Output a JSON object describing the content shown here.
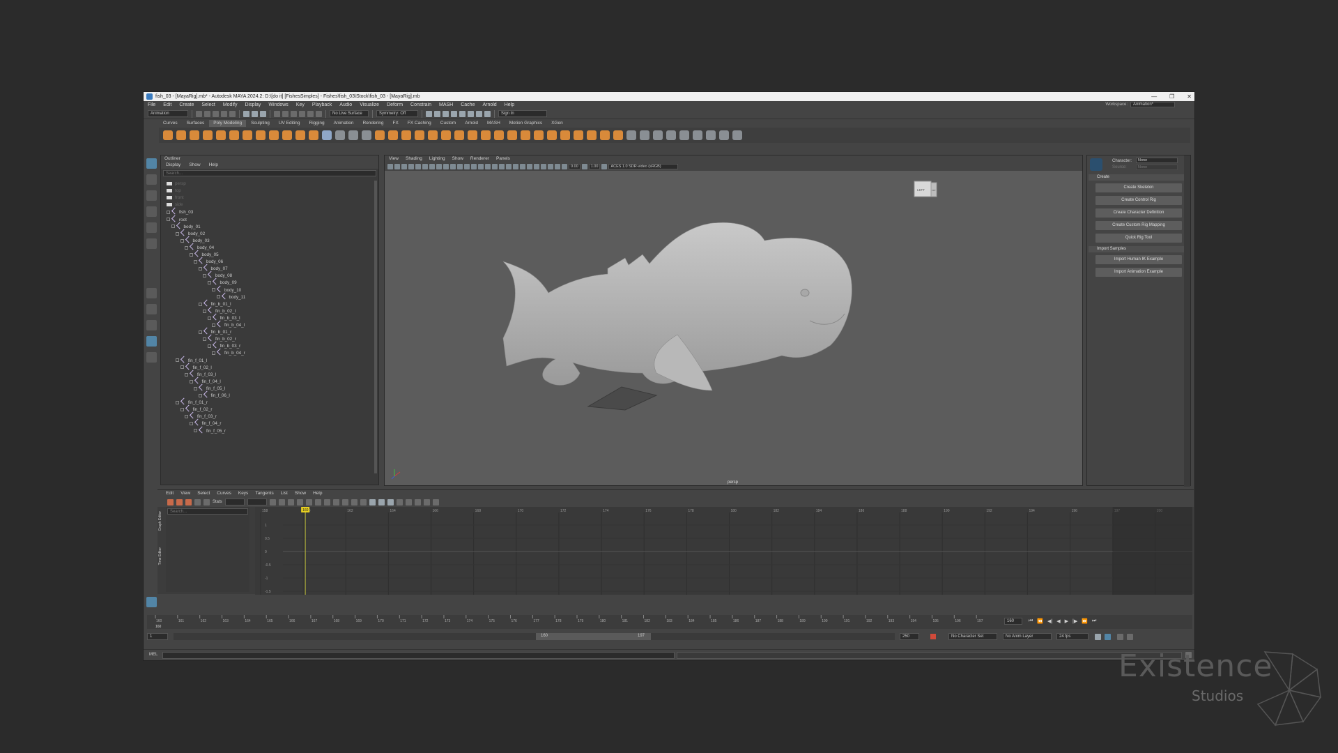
{
  "window": {
    "title": "fish_03 - [MayaRig].mb* - Autodesk MAYA 2024.2: D:\\[do it] [FishesSimples] - Fishes\\fish_03\\Stock\\fish_03 - [MayaRig].mb",
    "min": "—",
    "max": "❐",
    "close": "✕"
  },
  "menu": [
    "File",
    "Edit",
    "Create",
    "Select",
    "Modify",
    "Display",
    "Windows",
    "Key",
    "Playback",
    "Audio",
    "Visualize",
    "Deform",
    "Constrain",
    "MASH",
    "Cache",
    "Arnold",
    "Help"
  ],
  "workspace": {
    "label": "Workspace:",
    "value": "Animation*"
  },
  "status": {
    "mode": "Animation",
    "live": "No Live Surface",
    "symmetry": "Symmetry: Off",
    "signin": "Sign In"
  },
  "shelf_tabs": [
    "Curves",
    "Surfaces",
    "Poly Modeling",
    "Sculpting",
    "UV Editing",
    "Rigging",
    "Animation",
    "Rendering",
    "FX",
    "FX Caching",
    "Custom",
    "Arnold",
    "MASH",
    "Motion Graphics",
    "XGen"
  ],
  "shelf_active": "Poly Modeling",
  "outliner": {
    "title": "Outliner",
    "menu": [
      "Display",
      "Show",
      "Help"
    ],
    "search": "Search...",
    "rows": [
      {
        "label": "persp",
        "indent": 0,
        "kind": "cam",
        "dim": true
      },
      {
        "label": "top",
        "indent": 0,
        "kind": "cam",
        "dim": true
      },
      {
        "label": "front",
        "indent": 0,
        "kind": "cam",
        "dim": true
      },
      {
        "label": "side",
        "indent": 0,
        "kind": "cam",
        "dim": true
      },
      {
        "label": "fish_03",
        "indent": 0,
        "kind": "mesh"
      },
      {
        "label": "root",
        "indent": 0,
        "kind": "joint"
      },
      {
        "label": "body_01",
        "indent": 1,
        "kind": "joint"
      },
      {
        "label": "body_02",
        "indent": 2,
        "kind": "joint"
      },
      {
        "label": "body_03",
        "indent": 3,
        "kind": "joint"
      },
      {
        "label": "body_04",
        "indent": 4,
        "kind": "joint"
      },
      {
        "label": "body_05",
        "indent": 5,
        "kind": "joint"
      },
      {
        "label": "body_06",
        "indent": 6,
        "kind": "joint"
      },
      {
        "label": "body_07",
        "indent": 7,
        "kind": "joint"
      },
      {
        "label": "body_08",
        "indent": 8,
        "kind": "joint"
      },
      {
        "label": "body_09",
        "indent": 9,
        "kind": "joint"
      },
      {
        "label": "body_10",
        "indent": 10,
        "kind": "joint"
      },
      {
        "label": "body_11",
        "indent": 11,
        "kind": "joint"
      },
      {
        "label": "fin_b_01_l",
        "indent": 7,
        "kind": "joint"
      },
      {
        "label": "fin_b_02_l",
        "indent": 8,
        "kind": "joint"
      },
      {
        "label": "fin_b_03_l",
        "indent": 9,
        "kind": "joint"
      },
      {
        "label": "fin_b_04_l",
        "indent": 10,
        "kind": "joint"
      },
      {
        "label": "fin_b_01_r",
        "indent": 7,
        "kind": "joint"
      },
      {
        "label": "fin_b_02_r",
        "indent": 8,
        "kind": "joint"
      },
      {
        "label": "fin_b_03_r",
        "indent": 9,
        "kind": "joint"
      },
      {
        "label": "fin_b_04_r",
        "indent": 10,
        "kind": "joint"
      },
      {
        "label": "fin_f_01_l",
        "indent": 2,
        "kind": "joint"
      },
      {
        "label": "fin_f_02_l",
        "indent": 3,
        "kind": "joint"
      },
      {
        "label": "fin_f_03_l",
        "indent": 4,
        "kind": "joint"
      },
      {
        "label": "fin_f_04_l",
        "indent": 5,
        "kind": "joint"
      },
      {
        "label": "fin_f_05_l",
        "indent": 6,
        "kind": "joint"
      },
      {
        "label": "fin_f_06_l",
        "indent": 7,
        "kind": "joint"
      },
      {
        "label": "fin_f_01_r",
        "indent": 2,
        "kind": "joint"
      },
      {
        "label": "fin_f_02_r",
        "indent": 3,
        "kind": "joint"
      },
      {
        "label": "fin_f_03_r",
        "indent": 4,
        "kind": "joint"
      },
      {
        "label": "fin_f_04_r",
        "indent": 5,
        "kind": "joint"
      },
      {
        "label": "fin_f_05_r",
        "indent": 6,
        "kind": "joint"
      }
    ]
  },
  "viewport": {
    "menu": [
      "View",
      "Shading",
      "Lighting",
      "Show",
      "Renderer",
      "Panels"
    ],
    "near": "0.00",
    "far": "1.00",
    "colorspace": "ACES 1.0 SDR-video (sRGB)",
    "camera": "persp",
    "cube_left": "LEFT",
    "cube_front": "FRT"
  },
  "humanik": {
    "character_label": "Character:",
    "character": "None",
    "source_label": "Source:",
    "source": "None",
    "create": "Create",
    "buttons": [
      "Create Skeleton",
      "Create Control Rig",
      "Create Character Definition",
      "Create Custom Rig Mapping",
      "Quick Rig Tool"
    ],
    "import": "Import Samples",
    "import_buttons": [
      "Import Human IK Example",
      "Import Animation Example"
    ]
  },
  "graph": {
    "menu": [
      "Edit",
      "View",
      "Select",
      "Curves",
      "Keys",
      "Tangents",
      "List",
      "Show",
      "Help"
    ],
    "stats": "Stats",
    "search": "Search...",
    "side_label": "Graph Editor",
    "side_label2": "Time Editor",
    "ticks": [
      "158",
      "160",
      "162",
      "164",
      "166",
      "168",
      "170",
      "172",
      "174",
      "176",
      "178",
      "180",
      "182",
      "184",
      "186",
      "188",
      "190",
      "192",
      "194",
      "196",
      "197",
      "200"
    ],
    "yticks": [
      "1",
      "0.5",
      "0",
      "-0.5",
      "-1",
      "-1.5"
    ],
    "current": "160"
  },
  "timeslider": {
    "ticks": [
      "160",
      "161",
      "162",
      "163",
      "164",
      "165",
      "166",
      "167",
      "168",
      "169",
      "170",
      "171",
      "172",
      "173",
      "174",
      "175",
      "176",
      "177",
      "178",
      "179",
      "180",
      "181",
      "182",
      "183",
      "184",
      "185",
      "186",
      "187",
      "188",
      "189",
      "190",
      "191",
      "192",
      "193",
      "194",
      "195",
      "196",
      "197"
    ],
    "current": "160"
  },
  "range": {
    "start": "1",
    "inner_start": "160",
    "inner_end": "197",
    "end": "250",
    "charset": "No Character Set",
    "animlayer": "No Anim Layer",
    "fps": "24 fps"
  },
  "cmd": {
    "label": "MEL"
  },
  "watermark": {
    "brand": "Existence",
    "sub": "Studios"
  }
}
